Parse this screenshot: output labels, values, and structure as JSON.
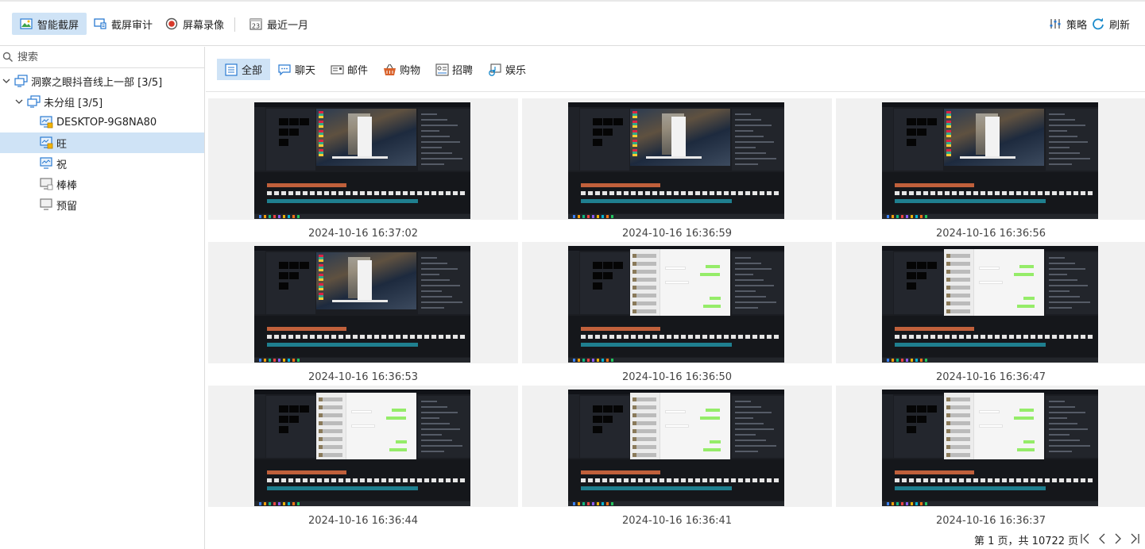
{
  "toolbar": {
    "items": [
      {
        "label": "智能截屏",
        "icon": "smart-screenshot-icon",
        "active": true
      },
      {
        "label": "截屏审计",
        "icon": "screenshot-audit-icon",
        "active": false
      },
      {
        "label": "屏幕录像",
        "icon": "screen-record-icon",
        "active": false
      },
      {
        "label": "最近一月",
        "icon": "calendar-icon",
        "active": false,
        "icon_text": "23"
      }
    ],
    "right": [
      {
        "label": "策略",
        "icon": "sliders-icon"
      },
      {
        "label": "刷新",
        "icon": "refresh-icon"
      }
    ]
  },
  "search": {
    "placeholder": "搜索",
    "value": ""
  },
  "tree": {
    "root": {
      "label": "洞察之眼抖音线上一部  [3/5]"
    },
    "group": {
      "label": "未分组  [3/5]"
    },
    "computers": [
      {
        "label": "DESKTOP-9G8NA80",
        "status": "online-locked"
      },
      {
        "label": "旺",
        "status": "online-locked",
        "selected": true
      },
      {
        "label": "祝",
        "status": "online"
      },
      {
        "label": "棒棒",
        "status": "offline"
      },
      {
        "label": "预留",
        "status": "offline"
      }
    ]
  },
  "filters": [
    {
      "label": "全部",
      "icon": "list-icon",
      "active": true
    },
    {
      "label": "聊天",
      "icon": "chat-icon",
      "active": false
    },
    {
      "label": "邮件",
      "icon": "mail-icon",
      "active": false
    },
    {
      "label": "购物",
      "icon": "cart-icon",
      "active": false
    },
    {
      "label": "招聘",
      "icon": "recruit-icon",
      "active": false
    },
    {
      "label": "娱乐",
      "icon": "music-icon",
      "active": false
    }
  ],
  "screenshots": [
    {
      "time": "2024-10-16 16:37:02",
      "variant": "editor"
    },
    {
      "time": "2024-10-16 16:36:59",
      "variant": "editor"
    },
    {
      "time": "2024-10-16 16:36:56",
      "variant": "editor"
    },
    {
      "time": "2024-10-16 16:36:53",
      "variant": "editor"
    },
    {
      "time": "2024-10-16 16:36:50",
      "variant": "chat"
    },
    {
      "time": "2024-10-16 16:36:47",
      "variant": "chat"
    },
    {
      "time": "2024-10-16 16:36:44",
      "variant": "chat"
    },
    {
      "time": "2024-10-16 16:36:41",
      "variant": "chat"
    },
    {
      "time": "2024-10-16 16:36:37",
      "variant": "chat"
    }
  ],
  "pager": {
    "text": "第 1 页，共 10722 页"
  },
  "colors": {
    "accent": "#1a73c8",
    "selected_bg": "#cfe3f6",
    "chat_green": "#95ec69"
  }
}
